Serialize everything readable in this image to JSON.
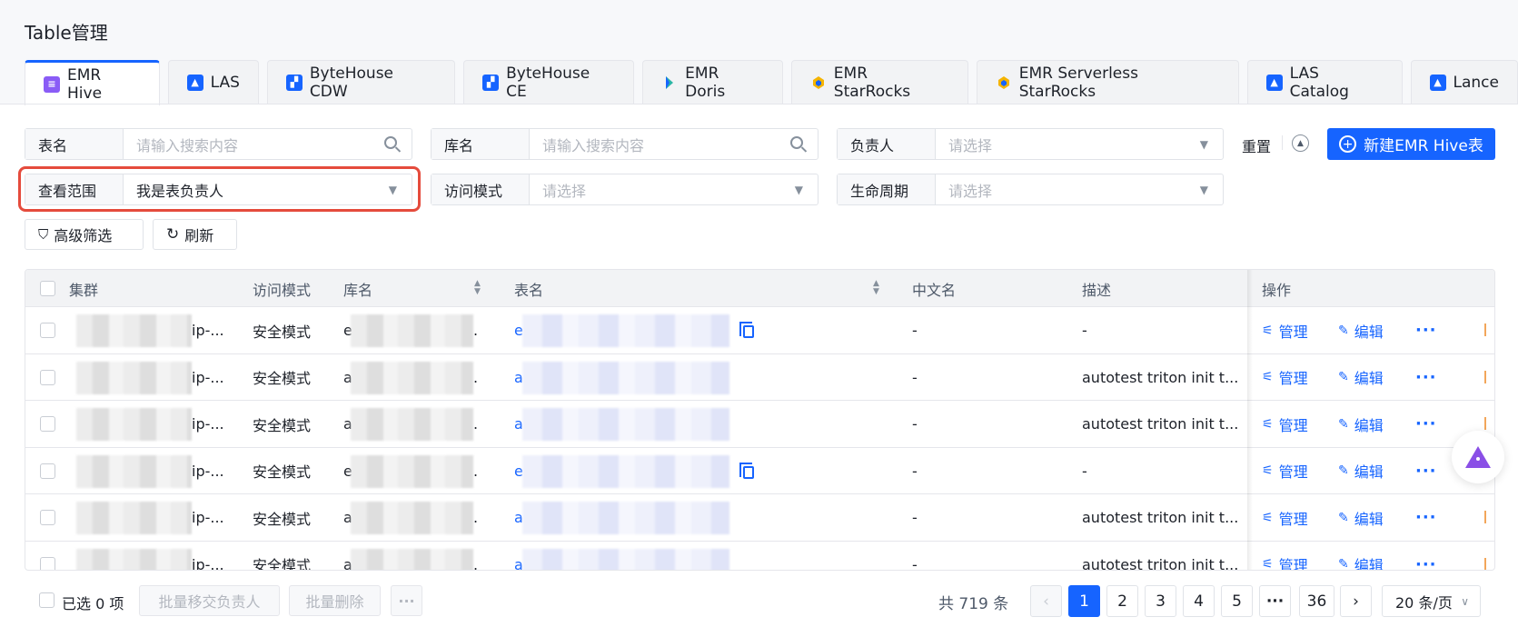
{
  "page": {
    "title": "Table管理"
  },
  "tabs": [
    {
      "label": "EMR Hive",
      "icon": "hive-icon"
    },
    {
      "label": "LAS",
      "icon": "las-icon"
    },
    {
      "label": "ByteHouse CDW",
      "icon": "bytehouse-icon"
    },
    {
      "label": "ByteHouse CE",
      "icon": "bytehouse-icon"
    },
    {
      "label": "EMR Doris",
      "icon": "doris-icon"
    },
    {
      "label": "EMR StarRocks",
      "icon": "starrocks-icon"
    },
    {
      "label": "EMR Serverless StarRocks",
      "icon": "starrocks-icon"
    },
    {
      "label": "LAS Catalog",
      "icon": "las-icon"
    },
    {
      "label": "Lance",
      "icon": "las-icon"
    }
  ],
  "filters": {
    "table_name": {
      "label": "表名",
      "placeholder": "请输入搜索内容"
    },
    "db_name": {
      "label": "库名",
      "placeholder": "请输入搜索内容"
    },
    "owner": {
      "label": "负责人",
      "placeholder": "请选择"
    },
    "scope": {
      "label": "查看范围",
      "value": "我是表负责人"
    },
    "access_mode": {
      "label": "访问模式",
      "placeholder": "请选择"
    },
    "lifecycle": {
      "label": "生命周期",
      "placeholder": "请选择"
    },
    "reset": "重置",
    "create_button": "新建EMR Hive表",
    "advanced_filter": "高级筛选",
    "refresh": "刷新"
  },
  "table": {
    "columns": [
      "集群",
      "访问模式",
      "库名",
      "表名",
      "中文名",
      "描述",
      "操作"
    ],
    "rows": [
      {
        "cluster_tail": "ip-...",
        "access": "安全模式",
        "db_head": "e",
        "table_head": "e",
        "copy": true,
        "cn_name": "-",
        "desc": "-"
      },
      {
        "cluster_tail": "ip-...",
        "access": "安全模式",
        "db_head": "a",
        "table_head": "a",
        "copy": false,
        "cn_name": "-",
        "desc": "autotest triton init t..."
      },
      {
        "cluster_tail": "ip-...",
        "access": "安全模式",
        "db_head": "a",
        "table_head": "a",
        "copy": false,
        "cn_name": "-",
        "desc": "autotest triton init t..."
      },
      {
        "cluster_tail": "ip-...",
        "access": "安全模式",
        "db_head": "e",
        "table_head": "e",
        "copy": true,
        "cn_name": "-",
        "desc": "-"
      },
      {
        "cluster_tail": "ip-...",
        "access": "安全模式",
        "db_head": "a",
        "table_head": "a",
        "copy": false,
        "cn_name": "-",
        "desc": "autotest triton init t..."
      },
      {
        "cluster_tail": "ip-...",
        "access": "安全模式",
        "db_head": "a",
        "table_head": "a",
        "copy": false,
        "cn_name": "-",
        "desc": "autotest triton init t..."
      }
    ],
    "actions": {
      "manage": "管理",
      "edit": "编辑",
      "more": "···"
    }
  },
  "footer": {
    "selected": "已选 0 项",
    "batch_transfer": "批量移交负责人",
    "batch_delete": "批量删除",
    "more": "···",
    "total": "共 719 条",
    "pages": [
      "1",
      "2",
      "3",
      "4",
      "5",
      "···",
      "36"
    ],
    "prev": "‹",
    "next": "›",
    "page_size": "20 条/页"
  },
  "colors": {
    "primary": "#1664ff",
    "highlight": "#e54b3c"
  }
}
